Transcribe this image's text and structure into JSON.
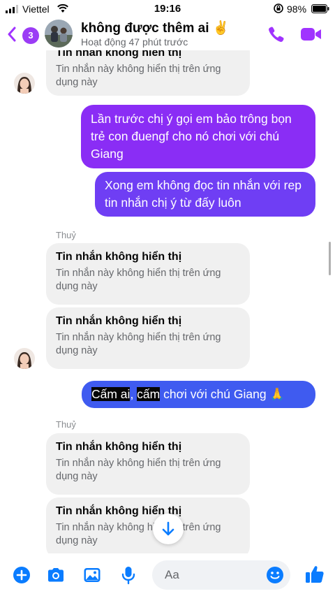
{
  "status_bar": {
    "carrier": "Viettel",
    "time": "19:16",
    "battery": "98%"
  },
  "header": {
    "unread_count": "3",
    "name": "không được thêm ai ✌️",
    "active_status": "Hoạt động 47 phút trước"
  },
  "messages": [
    {
      "type": "incoming",
      "title": "Tin nhắn không hiển thị",
      "body": "Tin nhắn này không hiển thị trên ứng dụng này"
    },
    {
      "type": "outgoing",
      "text": "Lần trước chị ý gọi em bảo trông bọn trẻ con đuengf cho nó chơi với chú Giang"
    },
    {
      "type": "outgoing",
      "text": "Xong em không đọc tin nhắn với rep tin nhắn chị ý từ đấy luôn"
    },
    {
      "type": "sender",
      "name": "Thuỷ"
    },
    {
      "type": "incoming",
      "title": "Tin nhắn không hiển thị",
      "body": "Tin nhắn này không hiển thị trên ứng dụng này"
    },
    {
      "type": "incoming",
      "title": "Tin nhắn không hiển thị",
      "body": "Tin nhắn này không hiển thị trên ứng dụng này"
    },
    {
      "type": "outgoing",
      "part1": "Cấm ai",
      "part2": ", ",
      "part3": "cấm",
      "part4": " chơi với chú Giang 🙏"
    },
    {
      "type": "sender",
      "name": "Thuỷ"
    },
    {
      "type": "incoming",
      "title": "Tin nhắn không hiển thị",
      "body": "Tin nhắn này không hiển thị trên ứng dụng này"
    },
    {
      "type": "incoming",
      "title": "Tin nhắn không hiển thị",
      "body": "Tin nhắn này không hiển thị trên ứng dụng này"
    }
  ],
  "composer": {
    "placeholder": "Aa"
  },
  "icons": {
    "back": "chevron-left-icon",
    "call": "phone-icon",
    "video": "video-camera-icon",
    "add": "plus-circle-icon",
    "camera": "camera-icon",
    "image": "image-icon",
    "mic": "microphone-icon",
    "emoji": "smiley-icon",
    "like": "thumbs-up-icon",
    "scroll": "arrow-down-icon"
  },
  "colors": {
    "accent": "#a033ff",
    "bubble_out_top": "#8a2df5",
    "bubble_out_bottom": "#3f5bf0",
    "bubble_in": "#f0f0f0",
    "composer_icon": "#0a7cff"
  }
}
